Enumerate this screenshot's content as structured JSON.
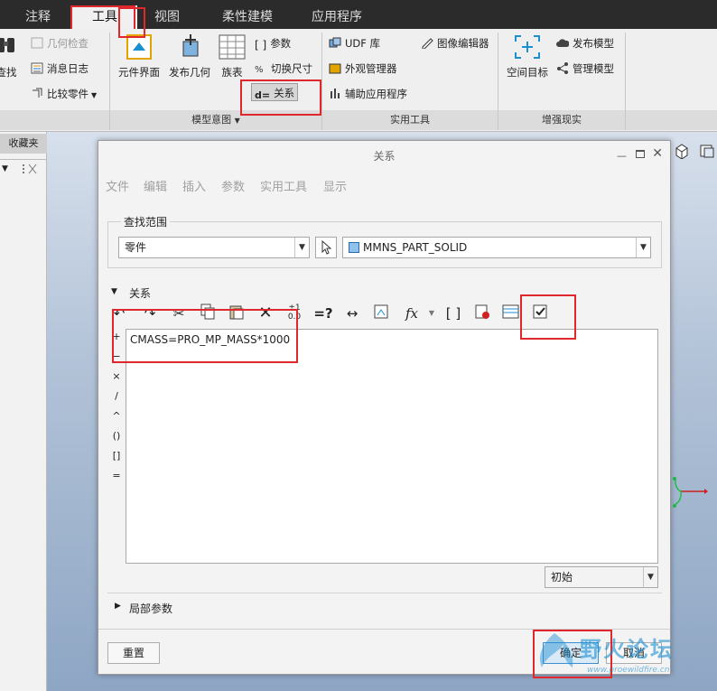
{
  "ribbon_tabs": [
    "注释",
    "工具",
    "视图",
    "柔性建模",
    "应用程序"
  ],
  "ribbon": {
    "search_label": "查找",
    "geom_check": "几何检查",
    "msg_log": "消息日志",
    "compare_parts": "比较零件",
    "element_interface": "元件界面",
    "publish_geom": "发布几何",
    "family_table": "族表",
    "params": "参数",
    "switch_dims": "切换尺寸",
    "relations": "关系",
    "group_model_intent": "模型意图",
    "udf_lib": "UDF 库",
    "appearance_mgr": "外观管理器",
    "aux_apps": "辅助应用程序",
    "image_editor": "图像编辑器",
    "group_utilities": "实用工具",
    "space_target": "空间目标",
    "publish_model": "发布模型",
    "manage_model": "管理模型",
    "group_augmented": "增强现实"
  },
  "left_panel": {
    "favorites": "收藏夹"
  },
  "dialog": {
    "title": "关系",
    "menus": [
      "文件",
      "编辑",
      "插入",
      "参数",
      "实用工具",
      "显示"
    ],
    "scope_label": "查找范围",
    "scope_type": "零件",
    "scope_object": "MMNS_PART_SOLID",
    "relations_label": "关系",
    "operators": [
      "+",
      "−",
      "×",
      "/",
      "^",
      "()",
      "[]",
      "="
    ],
    "relation_text": "CMASS=PRO_MP_MASS*1000",
    "sort_option": "初始",
    "local_params_label": "局部参数",
    "reset_label": "重置",
    "ok_label": "确定",
    "cancel_label": "取消"
  },
  "watermark": {
    "title": "野火论坛",
    "url": "www.proewildfire.cn"
  },
  "colors": {
    "highlight": "#e0282c",
    "accent": "#1a8fd1"
  }
}
